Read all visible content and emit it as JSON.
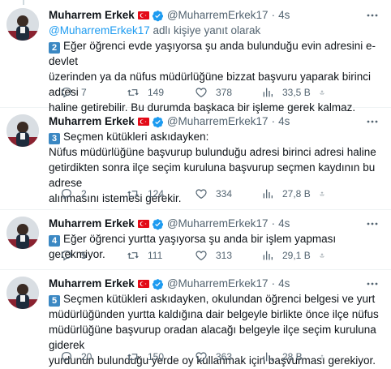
{
  "author": {
    "name": "Muharrem Erkek",
    "handle": "@MuharremErkek17",
    "colors": {
      "verified": "#1d9bf0",
      "flag": "#e30a17",
      "number_badge": "#3b88c3"
    }
  },
  "tweets": [
    {
      "time": "4s",
      "reply_prefix": "",
      "reply_mention": "@MuharremErkek17",
      "reply_suffix": " adlı kişiye yanıt olarak",
      "number": "2",
      "lines": [
        "Eğer öğrenci evde yaşıyorsa şu anda bulunduğu evin adresini e-devlet",
        "üzerinden ya da nüfus müdürlüğüne bizzat başvuru yaparak birinci adresi",
        "haline getirebilir. Bu durumda başkaca bir işleme gerek kalmaz."
      ],
      "replies": "7",
      "retweets": "149",
      "likes": "378",
      "views": "33,5 B"
    },
    {
      "time": "4s",
      "number": "3",
      "lines": [
        "Seçmen kütükleri askıdayken:",
        "Nüfus müdürlüğüne başvurup bulunduğu adresi birinci adresi haline",
        "getirdikten sonra ilçe seçim kuruluna başvurup seçmen kaydının bu adrese",
        "alınmasını istemesi gerekir."
      ],
      "replies": "2",
      "retweets": "124",
      "likes": "334",
      "views": "27,8 B"
    },
    {
      "time": "4s",
      "number": "4",
      "lines": [
        "Eğer öğrenci yurtta yaşıyorsa şu anda bir işlem yapması gerekmiyor."
      ],
      "replies": "5",
      "retweets": "111",
      "likes": "313",
      "views": "29,1 B"
    },
    {
      "time": "4s",
      "number": "5",
      "lines": [
        "Seçmen kütükleri askıdayken, okulundan öğrenci belgesi ve yurt",
        "müdürlüğünden yurtta kaldığına dair belgeyle birlikte önce ilçe nüfus",
        "müdürlüğüne başvurup oradan alacağı belgeyle ilçe seçim kuruluna giderek",
        "yurdunun bulunduğu yerde oy kullanmak için başvurması gerekiyor."
      ],
      "replies": "20",
      "retweets": "150",
      "likes": "363",
      "views": "28 B"
    }
  ],
  "icons": {
    "more": "more-dots-icon",
    "reply": "reply-icon",
    "retweet": "retweet-icon",
    "like": "heart-icon",
    "views": "views-chart-icon",
    "share": "share-icon",
    "verified": "verified-badge-icon",
    "flag": "turkey-flag-icon"
  }
}
